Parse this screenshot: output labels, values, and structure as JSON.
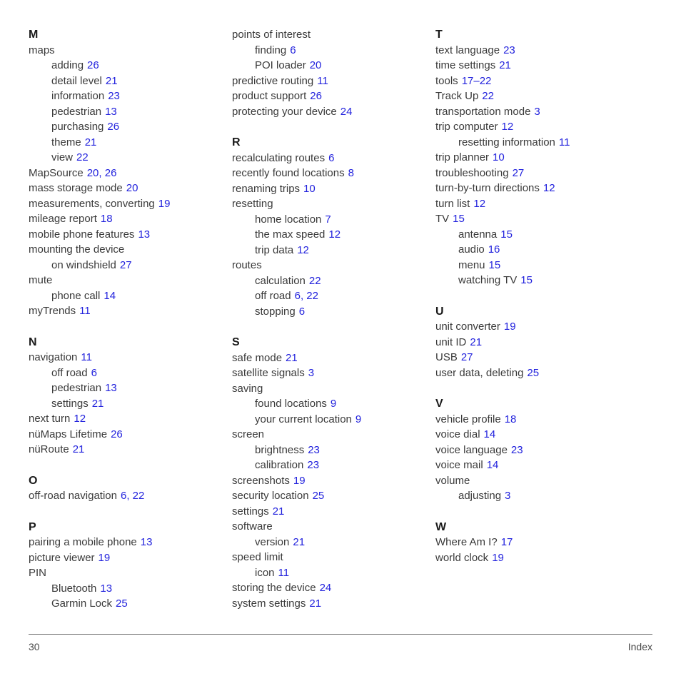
{
  "document": {
    "footer": {
      "page_number": "30",
      "section_label": "Index"
    }
  },
  "columns": [
    {
      "id": "column-1",
      "sections": [
        {
          "letter": "M",
          "entries": [
            {
              "label": "maps",
              "pages": "",
              "level": 0
            },
            {
              "label": "adding",
              "pages": "26",
              "level": 1
            },
            {
              "label": "detail level",
              "pages": "21",
              "level": 1
            },
            {
              "label": "information",
              "pages": "23",
              "level": 1
            },
            {
              "label": "pedestrian",
              "pages": "13",
              "level": 1
            },
            {
              "label": "purchasing",
              "pages": "26",
              "level": 1
            },
            {
              "label": "theme",
              "pages": "21",
              "level": 1
            },
            {
              "label": "view",
              "pages": "22",
              "level": 1
            },
            {
              "label": "MapSource",
              "pages": "20, 26",
              "level": 0
            },
            {
              "label": "mass storage mode",
              "pages": "20",
              "level": 0
            },
            {
              "label": "measurements, converting",
              "pages": "19",
              "level": 0
            },
            {
              "label": "mileage report",
              "pages": "18",
              "level": 0
            },
            {
              "label": "mobile phone features",
              "pages": "13",
              "level": 0
            },
            {
              "label": "mounting the device",
              "pages": "",
              "level": 0
            },
            {
              "label": "on windshield",
              "pages": "27",
              "level": 1
            },
            {
              "label": "mute",
              "pages": "",
              "level": 0
            },
            {
              "label": "phone call",
              "pages": "14",
              "level": 1
            },
            {
              "label": "myTrends",
              "pages": "11",
              "level": 0
            }
          ]
        },
        {
          "letter": "N",
          "entries": [
            {
              "label": "navigation",
              "pages": "11",
              "level": 0
            },
            {
              "label": "off road",
              "pages": "6",
              "level": 1
            },
            {
              "label": "pedestrian",
              "pages": "13",
              "level": 1
            },
            {
              "label": "settings",
              "pages": "21",
              "level": 1
            },
            {
              "label": "next turn",
              "pages": "12",
              "level": 0
            },
            {
              "label": "nüMaps Lifetime",
              "pages": "26",
              "level": 0
            },
            {
              "label": "nüRoute",
              "pages": "21",
              "level": 0
            }
          ]
        },
        {
          "letter": "O",
          "entries": [
            {
              "label": "off-road navigation",
              "pages": "6, 22",
              "level": 0
            }
          ]
        },
        {
          "letter": "P",
          "entries": [
            {
              "label": "pairing a mobile phone",
              "pages": "13",
              "level": 0
            },
            {
              "label": "picture viewer",
              "pages": "19",
              "level": 0
            },
            {
              "label": "PIN",
              "pages": "",
              "level": 0
            },
            {
              "label": "Bluetooth",
              "pages": "13",
              "level": 1
            },
            {
              "label": "Garmin Lock",
              "pages": "25",
              "level": 1
            }
          ]
        }
      ]
    },
    {
      "id": "column-2",
      "sections": [
        {
          "letter": "",
          "entries": [
            {
              "label": "points of interest",
              "pages": "",
              "level": 0
            },
            {
              "label": "finding",
              "pages": "6",
              "level": 1
            },
            {
              "label": "POI loader",
              "pages": "20",
              "level": 1
            },
            {
              "label": "predictive routing",
              "pages": "11",
              "level": 0
            },
            {
              "label": "product support",
              "pages": "26",
              "level": 0
            },
            {
              "label": "protecting your device",
              "pages": "24",
              "level": 0
            }
          ]
        },
        {
          "letter": "R",
          "entries": [
            {
              "label": "recalculating routes",
              "pages": "6",
              "level": 0
            },
            {
              "label": "recently found locations",
              "pages": "8",
              "level": 0
            },
            {
              "label": "renaming trips",
              "pages": "10",
              "level": 0
            },
            {
              "label": "resetting",
              "pages": "",
              "level": 0
            },
            {
              "label": "home location",
              "pages": "7",
              "level": 1
            },
            {
              "label": "the max speed",
              "pages": "12",
              "level": 1
            },
            {
              "label": "trip data",
              "pages": "12",
              "level": 1
            },
            {
              "label": "routes",
              "pages": "",
              "level": 0
            },
            {
              "label": "calculation",
              "pages": "22",
              "level": 1
            },
            {
              "label": "off road",
              "pages": "6, 22",
              "level": 1
            },
            {
              "label": "stopping",
              "pages": "6",
              "level": 1
            }
          ]
        },
        {
          "letter": "S",
          "entries": [
            {
              "label": "safe mode",
              "pages": "21",
              "level": 0
            },
            {
              "label": "satellite signals",
              "pages": "3",
              "level": 0
            },
            {
              "label": "saving",
              "pages": "",
              "level": 0
            },
            {
              "label": "found locations",
              "pages": "9",
              "level": 1
            },
            {
              "label": "your current location",
              "pages": "9",
              "level": 1
            },
            {
              "label": "screen",
              "pages": "",
              "level": 0
            },
            {
              "label": "brightness",
              "pages": "23",
              "level": 1
            },
            {
              "label": "calibration",
              "pages": "23",
              "level": 1
            },
            {
              "label": "screenshots",
              "pages": "19",
              "level": 0
            },
            {
              "label": "security location",
              "pages": "25",
              "level": 0
            },
            {
              "label": "settings",
              "pages": "21",
              "level": 0
            },
            {
              "label": "software",
              "pages": "",
              "level": 0
            },
            {
              "label": "version",
              "pages": "21",
              "level": 1
            },
            {
              "label": "speed limit",
              "pages": "",
              "level": 0
            },
            {
              "label": "icon",
              "pages": "11",
              "level": 1
            },
            {
              "label": "storing the device",
              "pages": "24",
              "level": 0
            },
            {
              "label": "system settings",
              "pages": "21",
              "level": 0
            }
          ]
        }
      ]
    },
    {
      "id": "column-3",
      "sections": [
        {
          "letter": "T",
          "entries": [
            {
              "label": "text language",
              "pages": "23",
              "level": 0
            },
            {
              "label": "time settings",
              "pages": "21",
              "level": 0
            },
            {
              "label": "tools",
              "pages": "17–22",
              "level": 0
            },
            {
              "label": "Track Up",
              "pages": "22",
              "level": 0
            },
            {
              "label": "transportation mode",
              "pages": "3",
              "level": 0
            },
            {
              "label": "trip computer",
              "pages": "12",
              "level": 0
            },
            {
              "label": "resetting information",
              "pages": "11",
              "level": 1
            },
            {
              "label": "trip planner",
              "pages": "10",
              "level": 0
            },
            {
              "label": "troubleshooting",
              "pages": "27",
              "level": 0
            },
            {
              "label": "turn-by-turn directions",
              "pages": "12",
              "level": 0
            },
            {
              "label": "turn list",
              "pages": "12",
              "level": 0
            },
            {
              "label": "TV",
              "pages": "15",
              "level": 0
            },
            {
              "label": "antenna",
              "pages": "15",
              "level": 1
            },
            {
              "label": "audio",
              "pages": "16",
              "level": 1
            },
            {
              "label": "menu",
              "pages": "15",
              "level": 1
            },
            {
              "label": "watching TV",
              "pages": "15",
              "level": 1
            }
          ]
        },
        {
          "letter": "U",
          "entries": [
            {
              "label": "unit converter",
              "pages": "19",
              "level": 0
            },
            {
              "label": "unit ID",
              "pages": "21",
              "level": 0
            },
            {
              "label": "USB",
              "pages": "27",
              "level": 0
            },
            {
              "label": "user data, deleting",
              "pages": "25",
              "level": 0
            }
          ]
        },
        {
          "letter": "V",
          "entries": [
            {
              "label": "vehicle profile",
              "pages": "18",
              "level": 0
            },
            {
              "label": "voice dial",
              "pages": "14",
              "level": 0
            },
            {
              "label": "voice language",
              "pages": "23",
              "level": 0
            },
            {
              "label": "voice mail",
              "pages": "14",
              "level": 0
            },
            {
              "label": "volume",
              "pages": "",
              "level": 0
            },
            {
              "label": "adjusting",
              "pages": "3",
              "level": 1
            }
          ]
        },
        {
          "letter": "W",
          "entries": [
            {
              "label": "Where Am I?",
              "pages": "17",
              "level": 0
            },
            {
              "label": "world clock",
              "pages": "19",
              "level": 0
            }
          ]
        }
      ]
    }
  ],
  "colors": {
    "page_reference": "#2222dd",
    "body_text": "#3a3a3a",
    "heading_text": "#1a1a1a"
  }
}
